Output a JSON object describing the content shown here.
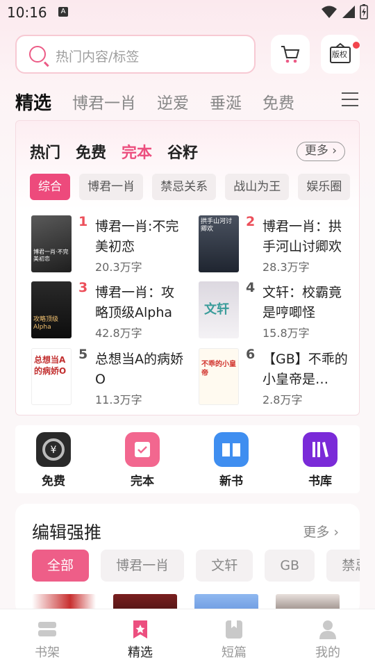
{
  "status": {
    "time": "10:16",
    "a_glyph": "A"
  },
  "search": {
    "placeholder": "热门内容/标签"
  },
  "header": {
    "copyright_label": "版权"
  },
  "tabs": [
    {
      "label": "精选",
      "active": true
    },
    {
      "label": "博君一肖"
    },
    {
      "label": "逆爱"
    },
    {
      "label": "垂涎"
    },
    {
      "label": "免费"
    }
  ],
  "ranking": {
    "tabs": [
      {
        "label": "热门"
      },
      {
        "label": "免费"
      },
      {
        "label": "完本",
        "selected": true
      },
      {
        "label": "谷籽"
      }
    ],
    "more_label": "更多",
    "chips": [
      {
        "label": "综合",
        "selected": true
      },
      {
        "label": "博君一肖"
      },
      {
        "label": "禁忌关系"
      },
      {
        "label": "战山为王"
      },
      {
        "label": "娱乐圈"
      }
    ],
    "books": [
      {
        "rank": "1",
        "title": "博君一肖:不完美初恋",
        "words": "20.3万字",
        "cover_text": "博君一肖·不完美初恋",
        "cover_color": "#3a3a3a"
      },
      {
        "rank": "2",
        "title": "博君一肖：拱手河山讨卿欢",
        "words": "28.3万字",
        "cover_text": "拱手山河讨卿欢",
        "cover_color": "#2b2f3a"
      },
      {
        "rank": "3",
        "title": "博君一肖：攻略顶级Alpha",
        "words": "42.8万字",
        "cover_text": "攻略顶级Alpha",
        "cover_color": "#1a1a1a"
      },
      {
        "rank": "4",
        "title": "文轩：校霸竟是哼唧怪",
        "words": "15.8万字",
        "cover_text": "文轩",
        "cover_color": "#e8e4ea"
      },
      {
        "rank": "5",
        "title": "总想当A的病娇O",
        "words": "11.3万字",
        "cover_text": "总想当A的病娇O",
        "cover_color": "#ffffff"
      },
      {
        "rank": "6",
        "title": "【GB】不乖的小皇帝是…",
        "words": "2.8万字",
        "cover_text": "不乖的小皇帝",
        "cover_color": "#fff8e6"
      }
    ]
  },
  "quick": [
    {
      "label": "免费",
      "icon": "coin-icon",
      "color": "#2a2a2a"
    },
    {
      "label": "完本",
      "icon": "calendar-check-icon",
      "color": "#f2678f"
    },
    {
      "label": "新书",
      "icon": "book-open-icon",
      "color": "#3f8ef0"
    },
    {
      "label": "书库",
      "icon": "library-icon",
      "color": "#7a2ad8"
    }
  ],
  "editor": {
    "title": "编辑强推",
    "more_label": "更多",
    "chips": [
      {
        "label": "全部",
        "selected": true
      },
      {
        "label": "博君一肖"
      },
      {
        "label": "文轩"
      },
      {
        "label": "GB"
      },
      {
        "label": "禁忌"
      }
    ]
  },
  "bottom_nav": [
    {
      "label": "书架",
      "icon": "shelf-icon"
    },
    {
      "label": "精选",
      "icon": "star-icon",
      "selected": true
    },
    {
      "label": "短篇",
      "icon": "short-book-icon"
    },
    {
      "label": "我的",
      "icon": "user-icon"
    }
  ]
}
